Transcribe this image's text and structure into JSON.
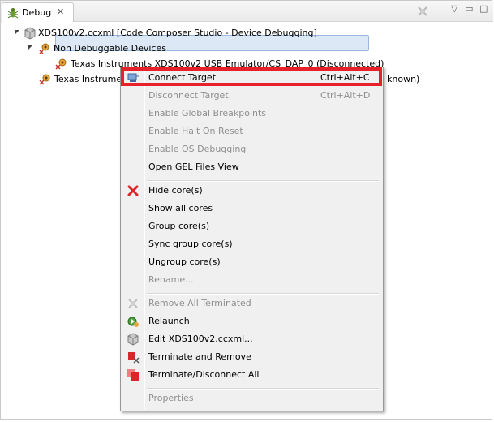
{
  "view": {
    "tab_label": "Debug",
    "tab_close": "✕",
    "minimize": "▭",
    "maximize": "□",
    "view_menu": "▽"
  },
  "tree": {
    "root_label": "XDS100v2.ccxml [Code Composer Studio - Device Debugging]",
    "group_label": "Non Debuggable Devices",
    "emulator_label": "Texas Instruments XDS100v2 USB Emulator/CS_DAP_0  (Disconnected)",
    "cpu_label_left": "Texas Instrumen",
    "cpu_label_right": "known)"
  },
  "menu": {
    "items": [
      {
        "label": "Connect Target",
        "shortcut": "Ctrl+Alt+C",
        "enabled": true,
        "icon": "connect-icon"
      },
      {
        "label": "Disconnect Target",
        "shortcut": "Ctrl+Alt+D",
        "enabled": false
      },
      {
        "label": "Enable Global Breakpoints",
        "enabled": false
      },
      {
        "label": "Enable Halt On Reset",
        "enabled": false
      },
      {
        "label": "Enable OS Debugging",
        "enabled": false
      },
      {
        "label": "Open GEL Files View",
        "enabled": true
      },
      {
        "label": "Hide core(s)",
        "enabled": true,
        "icon": "red-x-icon"
      },
      {
        "label": "Show all cores",
        "enabled": true
      },
      {
        "label": "Group core(s)",
        "enabled": true
      },
      {
        "label": "Sync group core(s)",
        "enabled": true
      },
      {
        "label": "Ungroup core(s)",
        "enabled": true
      },
      {
        "label": "Rename...",
        "enabled": false
      },
      {
        "label": "Remove All Terminated",
        "enabled": false,
        "icon": "remove-terminated-icon"
      },
      {
        "label": "Relaunch",
        "enabled": true,
        "icon": "relaunch-icon"
      },
      {
        "label": "Edit XDS100v2.ccxml...",
        "enabled": true,
        "icon": "edit-config-icon"
      },
      {
        "label": "Terminate and Remove",
        "enabled": true,
        "icon": "terminate-remove-icon"
      },
      {
        "label": "Terminate/Disconnect All",
        "enabled": true,
        "icon": "terminate-all-icon"
      },
      {
        "label": "Properties",
        "enabled": false
      }
    ]
  },
  "colors": {
    "highlight_border": "#e8202a",
    "selection_fill": "#dde8f6",
    "disabled_text": "#8f8f8f"
  }
}
